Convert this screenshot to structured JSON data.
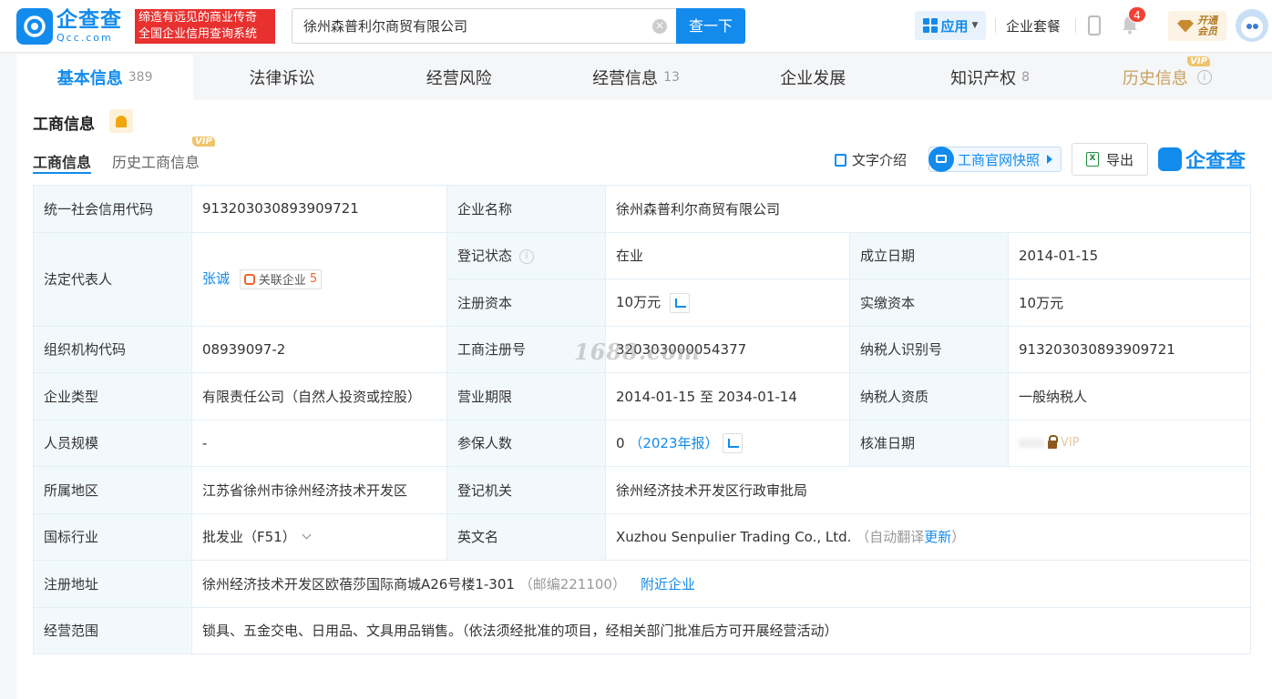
{
  "header": {
    "logo_cn": "企查查",
    "logo_en": "Qcc.com",
    "slogan_line1": "缔造有远见的商业传奇",
    "slogan_line2": "全国企业信用查询系统",
    "search_value": "徐州森普利尔商贸有限公司",
    "search_button": "查一下",
    "app_label": "应用",
    "suite_label": "企业套餐",
    "notification_count": "4",
    "vip_line1": "开通",
    "vip_line2": "会员"
  },
  "tabs": [
    {
      "label": "基本信息",
      "count": "389"
    },
    {
      "label": "法律诉讼",
      "count": ""
    },
    {
      "label": "经营风险",
      "count": ""
    },
    {
      "label": "经营信息",
      "count": "13"
    },
    {
      "label": "企业发展",
      "count": ""
    },
    {
      "label": "知识产权",
      "count": "8"
    },
    {
      "label": "历史信息",
      "count": "",
      "tag": "VIP"
    }
  ],
  "section": {
    "title": "工商信息",
    "subtab_active": "工商信息",
    "subtab_history": "历史工商信息",
    "subtab_history_tag": "VIP",
    "text_intro": "文字介绍",
    "snapshot": "工商官网快照",
    "export": "导出",
    "brand": "企查查"
  },
  "info": {
    "credit_code_label": "统一社会信用代码",
    "credit_code": "913203030893909721",
    "company_name_label": "企业名称",
    "company_name": "徐州森普利尔商贸有限公司",
    "legal_rep_label": "法定代表人",
    "legal_rep": "张诚",
    "related_label": "关联企业",
    "related_count": "5",
    "reg_status_label": "登记状态",
    "reg_status": "在业",
    "founded_label": "成立日期",
    "founded": "2014-01-15",
    "reg_capital_label": "注册资本",
    "reg_capital": "10万元",
    "paid_capital_label": "实缴资本",
    "paid_capital": "10万元",
    "org_code_label": "组织机构代码",
    "org_code": "08939097-2",
    "biz_reg_no_label": "工商注册号",
    "biz_reg_no": "320303000054377",
    "taxpayer_id_label": "纳税人识别号",
    "taxpayer_id": "913203030893909721",
    "company_type_label": "企业类型",
    "company_type": "有限责任公司（自然人投资或控股）",
    "term_label": "营业期限",
    "term": "2014-01-15 至 2034-01-14",
    "taxpayer_qual_label": "纳税人资质",
    "taxpayer_qual": "一般纳税人",
    "staff_size_label": "人员规模",
    "staff_size": "-",
    "insured_label": "参保人数",
    "insured": "0",
    "insured_year": "（2023年报）",
    "approved_label": "核准日期",
    "approved_locked": "VIP",
    "region_label": "所属地区",
    "region": "江苏省徐州市徐州经济技术开发区",
    "authority_label": "登记机关",
    "authority": "徐州经济技术开发区行政审批局",
    "industry_label": "国标行业",
    "industry": "批发业（F51）",
    "english_name_label": "英文名",
    "english_name": "Xuzhou Senpulier Trading Co., Ltd.",
    "auto_translate_prefix": "（自动翻译",
    "auto_translate_link": "更新",
    "auto_translate_suffix": "）",
    "address_label": "注册地址",
    "address": "徐州经济技术开发区欧蓓莎国际商城A26号楼1-301",
    "postcode": "（邮编221100）",
    "nearby": "附近企业",
    "scope_label": "经营范围",
    "scope": "锁具、五金交电、日用品、文具用品销售。（依法须经批准的项目，经相关部门批准后方可开展经营活动）"
  },
  "watermark": "1688.com",
  "colors": {
    "primary": "#128bed",
    "label_bg": "#f2f9fc",
    "slogan_bg": "#e8312f",
    "vip_gold": "#c8a05a"
  }
}
